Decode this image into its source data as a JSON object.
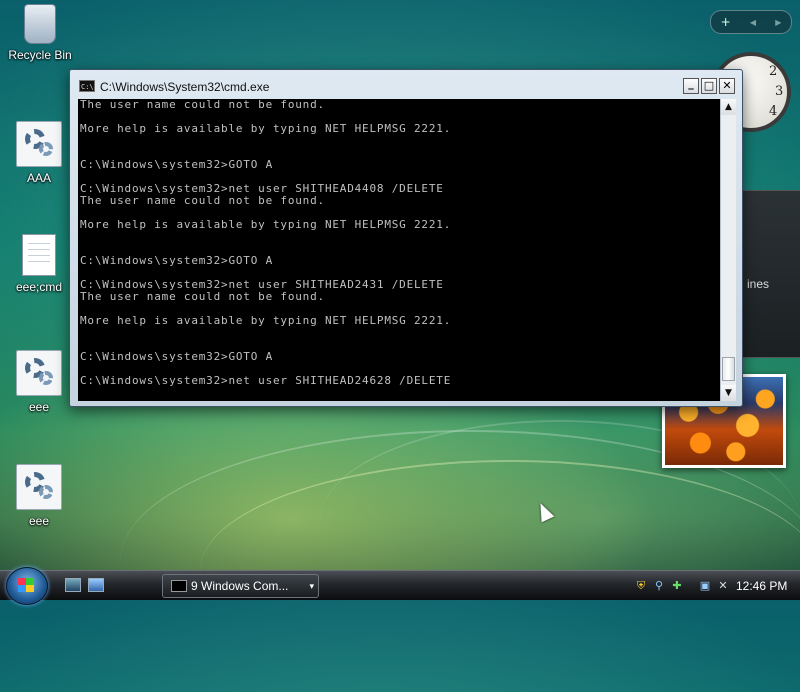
{
  "desktop": {
    "icons": [
      {
        "label": "Recycle Bin",
        "icon": "recycle-bin-icon"
      },
      {
        "label": "AAA",
        "icon": "gear-file-icon"
      },
      {
        "label": "eee;cmd",
        "icon": "text-file-icon"
      },
      {
        "label": "eee",
        "icon": "gear-file-icon"
      },
      {
        "label": "eee",
        "icon": "gear-file-icon"
      }
    ]
  },
  "sidebar": {
    "add_glyph": "+",
    "prev_glyph": "◀",
    "next_glyph": "▶",
    "clock_numbers": [
      "2",
      "3",
      "4"
    ],
    "feed_text": "ines"
  },
  "window": {
    "title": "C:\\Windows\\System32\\cmd.exe",
    "minimize_glyph": "_",
    "maximize_glyph": "□",
    "close_glyph": "✕",
    "console_lines": [
      "The user name could not be found.",
      "",
      "More help is available by typing NET HELPMSG 2221.",
      "",
      "",
      "C:\\Windows\\system32>GOTO A",
      "",
      "C:\\Windows\\system32>net user SHITHEAD4408 /DELETE",
      "The user name could not be found.",
      "",
      "More help is available by typing NET HELPMSG 2221.",
      "",
      "",
      "C:\\Windows\\system32>GOTO A",
      "",
      "C:\\Windows\\system32>net user SHITHEAD2431 /DELETE",
      "The user name could not be found.",
      "",
      "More help is available by typing NET HELPMSG 2221.",
      "",
      "",
      "C:\\Windows\\system32>GOTO A",
      "",
      "C:\\Windows\\system32>net user SHITHEAD24628 /DELETE"
    ],
    "scroll_up_glyph": "▲",
    "scroll_down_glyph": "▼"
  },
  "taskbar": {
    "task_button_label": "9 Windows Com...",
    "task_button_dropdown": "▾",
    "clock": "12:46 PM"
  },
  "colors": {
    "console_bg": "#000000",
    "console_fg": "#c0c0c0"
  }
}
